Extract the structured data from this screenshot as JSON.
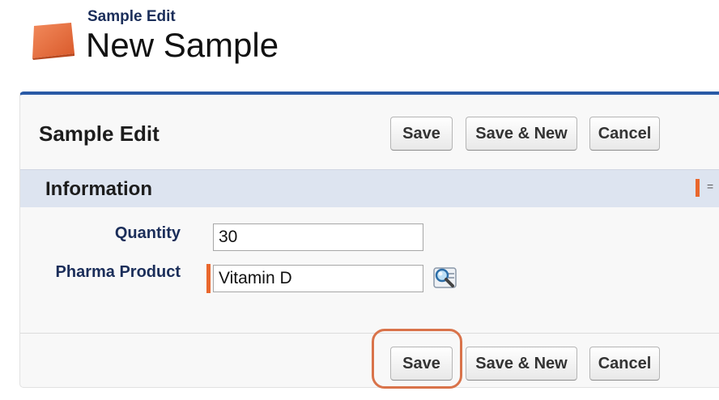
{
  "header": {
    "subtitle": "Sample Edit",
    "title": "New Sample"
  },
  "panel": {
    "title": "Sample Edit",
    "buttons": {
      "save": "Save",
      "save_new": "Save & New",
      "cancel": "Cancel"
    }
  },
  "section": {
    "title": "Information"
  },
  "fields": {
    "quantity": {
      "label": "Quantity",
      "value": "30"
    },
    "pharma_product": {
      "label": "Pharma Product",
      "value": "Vitamin D"
    }
  },
  "icons": {
    "page_icon": "sample-record-icon",
    "lookup_icon": "lookup-search-icon"
  },
  "colors": {
    "accent_blue": "#2a5aa6",
    "required_orange": "#e9672d",
    "label_navy": "#1b2e5a",
    "section_bg": "#dde4f0",
    "highlight": "#d9734a"
  }
}
